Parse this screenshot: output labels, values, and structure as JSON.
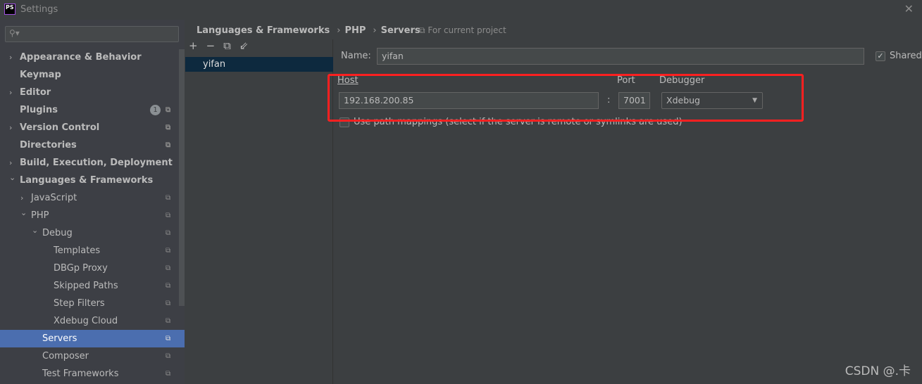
{
  "window": {
    "title": "Settings",
    "logo": "PS"
  },
  "search": {
    "placeholder": "",
    "icon": "search-icon"
  },
  "tree": [
    {
      "label": "Appearance & Behavior",
      "level": 0,
      "bold": true,
      "arrow": "›",
      "copy": false
    },
    {
      "label": "Keymap",
      "level": 0,
      "bold": true,
      "arrow": "",
      "copy": false
    },
    {
      "label": "Editor",
      "level": 0,
      "bold": true,
      "arrow": "›",
      "copy": false
    },
    {
      "label": "Plugins",
      "level": 0,
      "bold": true,
      "arrow": "",
      "copy": true,
      "badge": "1"
    },
    {
      "label": "Version Control",
      "level": 0,
      "bold": true,
      "arrow": "›",
      "copy": true
    },
    {
      "label": "Directories",
      "level": 0,
      "bold": true,
      "arrow": "",
      "copy": true
    },
    {
      "label": "Build, Execution, Deployment",
      "level": 0,
      "bold": true,
      "arrow": "›",
      "copy": false
    },
    {
      "label": "Languages & Frameworks",
      "level": 0,
      "bold": true,
      "arrow": "⌄",
      "copy": false
    },
    {
      "label": "JavaScript",
      "level": 1,
      "arrow": "›",
      "copy": true
    },
    {
      "label": "PHP",
      "level": 1,
      "arrow": "⌄",
      "copy": true
    },
    {
      "label": "Debug",
      "level": 2,
      "arrow": "⌄",
      "copy": true
    },
    {
      "label": "Templates",
      "level": 3,
      "arrow": "",
      "copy": true
    },
    {
      "label": "DBGp Proxy",
      "level": 3,
      "arrow": "",
      "copy": true
    },
    {
      "label": "Skipped Paths",
      "level": 3,
      "arrow": "",
      "copy": true
    },
    {
      "label": "Step Filters",
      "level": 3,
      "arrow": "",
      "copy": true
    },
    {
      "label": "Xdebug Cloud",
      "level": 3,
      "arrow": "",
      "copy": true
    },
    {
      "label": "Servers",
      "level": 2,
      "arrow": "",
      "copy": true,
      "selected": true
    },
    {
      "label": "Composer",
      "level": 2,
      "arrow": "",
      "copy": true
    },
    {
      "label": "Test Frameworks",
      "level": 2,
      "arrow": "",
      "copy": true
    }
  ],
  "breadcrumb": [
    "Languages & Frameworks",
    "PHP",
    "Servers"
  ],
  "scope": "For current project",
  "servers": {
    "items": [
      "yifan"
    ],
    "selected": "yifan"
  },
  "form": {
    "name_label": "Name:",
    "name_value": "yifan",
    "shared_label": "Shared",
    "shared_checked": true,
    "host_label": "Host",
    "host_value": "192.168.200.85",
    "port_sep": ":",
    "port_label": "Port",
    "port_value": "7001",
    "debugger_label": "Debugger",
    "debugger_value": "Xdebug",
    "path_mappings_label": "Use path mappings (select if the server is remote or symlinks are used)",
    "path_mappings_checked": false
  },
  "watermark": "CSDN @.卡",
  "colors": {
    "selection": "#4b6eaf",
    "list_selection": "#0d293e",
    "highlight_box": "#ff2020"
  }
}
